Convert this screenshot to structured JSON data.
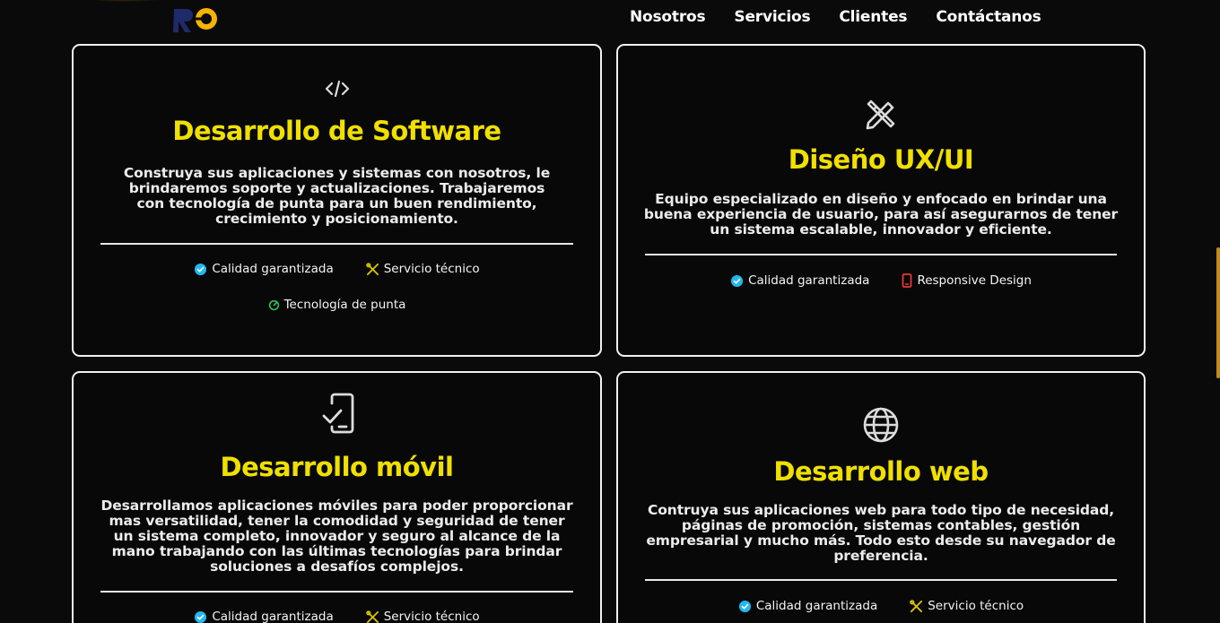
{
  "nav": {
    "items": [
      "Nosotros",
      "Servicios",
      "Clientes",
      "Contáctanos"
    ]
  },
  "colors": {
    "accent_yellow": "#f0e000",
    "verified_blue": "#22b8f0",
    "tools_yellow": "#d9c400",
    "tech_green": "#22c55e",
    "phone_red": "#e53935",
    "background": "#0a0a0a"
  },
  "cards": [
    {
      "icon": "code-icon",
      "title": "Desarrollo de Software",
      "description": "Construya sus aplicaciones y sistemas con nosotros, le brindaremos soporte y actualizaciones. Trabajaremos con tecnología de punta para un buen rendimiento, crecimiento y posicionamiento.",
      "badges": [
        {
          "icon": "verified-icon",
          "label": "Calidad garantizada"
        },
        {
          "icon": "tools-icon",
          "label": "Servicio técnico"
        },
        {
          "icon": "rocket-icon",
          "label": "Tecnología de punta"
        }
      ]
    },
    {
      "icon": "design-tools-icon",
      "title": "Diseño UX/UI",
      "description": "Equipo especializado en diseño y enfocado en brindar una buena experiencia de usuario, para así asegurarnos de tener un sistema escalable, innovador y eficiente.",
      "badges": [
        {
          "icon": "verified-icon",
          "label": "Calidad garantizada"
        },
        {
          "icon": "mobile-icon",
          "label": "Responsive Design"
        }
      ]
    },
    {
      "icon": "mobile-check-icon",
      "title": "Desarrollo móvil",
      "description": "Desarrollamos aplicaciones móviles para poder proporcionar mas versatilidad, tener la comodidad y seguridad de tener un sistema completo, innovador y seguro al alcance de la mano trabajando con las últimas tecnologías para brindar soluciones a desafíos complejos.",
      "badges": [
        {
          "icon": "verified-icon",
          "label": "Calidad garantizada"
        },
        {
          "icon": "tools-icon",
          "label": "Servicio técnico"
        }
      ]
    },
    {
      "icon": "globe-icon",
      "title": "Desarrollo web",
      "description": "Contruya sus aplicaciones web para todo tipo de necesidad, páginas de promoción, sistemas contables, gestión empresarial y mucho más. Todo esto desde su navegador de preferencia.",
      "badges": [
        {
          "icon": "verified-icon",
          "label": "Calidad garantizada"
        },
        {
          "icon": "tools-icon",
          "label": "Servicio técnico"
        }
      ]
    }
  ]
}
